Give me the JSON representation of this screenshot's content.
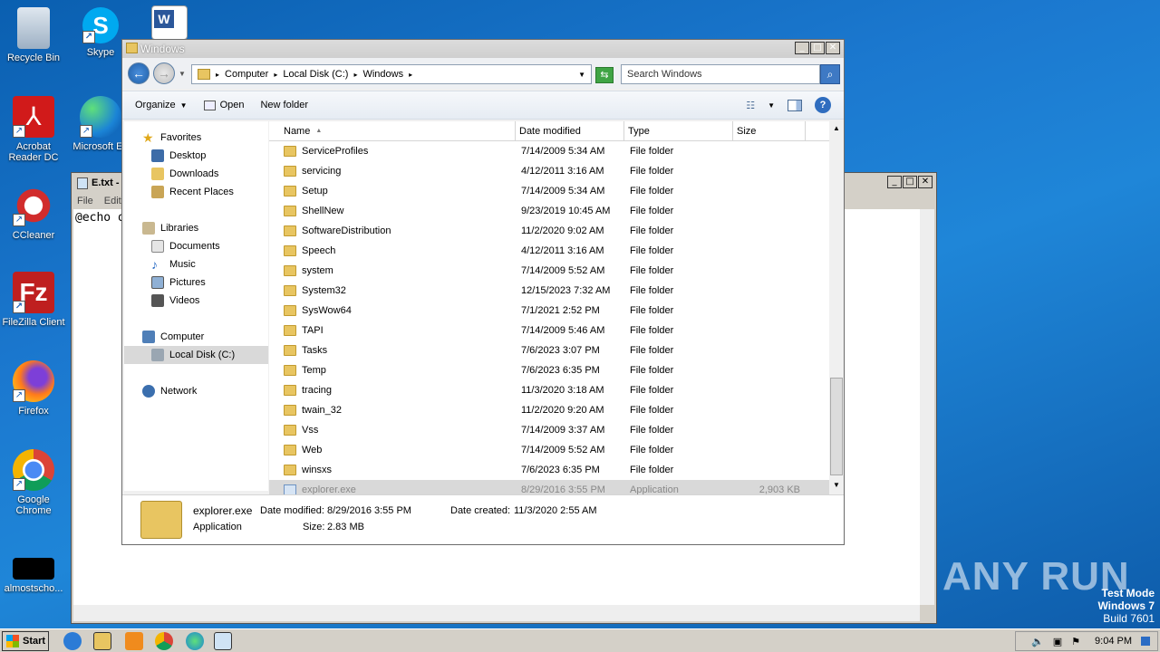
{
  "desktop": {
    "icons": [
      {
        "label": "Recycle Bin"
      },
      {
        "label": "Skype"
      },
      {
        "label": "Acrobat Reader DC"
      },
      {
        "label": "Microsoft Ed"
      },
      {
        "label": "CCleaner"
      },
      {
        "label": "FileZilla Client"
      },
      {
        "label": "Firefox"
      },
      {
        "label": "Google Chrome"
      },
      {
        "label": "almostscho..."
      }
    ],
    "watermark": "ANY RUN",
    "test_mode": {
      "line1": "Test Mode",
      "line2": "Windows 7",
      "line3": "Build 7601"
    }
  },
  "notepad": {
    "title": "E.txt -",
    "menu": [
      "File",
      "Edit"
    ],
    "text": "@echo o"
  },
  "explorer": {
    "title": "Windows",
    "address": {
      "segments": [
        "Computer",
        "Local Disk (C:)",
        "Windows"
      ]
    },
    "search_placeholder": "Search Windows",
    "toolbar": {
      "organize": "Organize",
      "open": "Open",
      "new_folder": "New folder"
    },
    "nav": {
      "favorites": "Favorites",
      "desktop": "Desktop",
      "downloads": "Downloads",
      "recent": "Recent Places",
      "libraries": "Libraries",
      "documents": "Documents",
      "music": "Music",
      "pictures": "Pictures",
      "videos": "Videos",
      "computer": "Computer",
      "local_disk": "Local Disk (C:)",
      "network": "Network"
    },
    "columns": {
      "name": "Name",
      "date": "Date modified",
      "type": "Type",
      "size": "Size"
    },
    "rows": [
      {
        "name": "ServiceProfiles",
        "date": "7/14/2009 5:34 AM",
        "type": "File folder",
        "size": ""
      },
      {
        "name": "servicing",
        "date": "4/12/2011 3:16 AM",
        "type": "File folder",
        "size": ""
      },
      {
        "name": "Setup",
        "date": "7/14/2009 5:34 AM",
        "type": "File folder",
        "size": ""
      },
      {
        "name": "ShellNew",
        "date": "9/23/2019 10:45 AM",
        "type": "File folder",
        "size": ""
      },
      {
        "name": "SoftwareDistribution",
        "date": "11/2/2020 9:02 AM",
        "type": "File folder",
        "size": ""
      },
      {
        "name": "Speech",
        "date": "4/12/2011 3:16 AM",
        "type": "File folder",
        "size": ""
      },
      {
        "name": "system",
        "date": "7/14/2009 5:52 AM",
        "type": "File folder",
        "size": ""
      },
      {
        "name": "System32",
        "date": "12/15/2023 7:32 AM",
        "type": "File folder",
        "size": ""
      },
      {
        "name": "SysWow64",
        "date": "7/1/2021 2:52 PM",
        "type": "File folder",
        "size": ""
      },
      {
        "name": "TAPI",
        "date": "7/14/2009 5:46 AM",
        "type": "File folder",
        "size": ""
      },
      {
        "name": "Tasks",
        "date": "7/6/2023 3:07 PM",
        "type": "File folder",
        "size": ""
      },
      {
        "name": "Temp",
        "date": "7/6/2023 6:35 PM",
        "type": "File folder",
        "size": ""
      },
      {
        "name": "tracing",
        "date": "11/3/2020 3:18 AM",
        "type": "File folder",
        "size": ""
      },
      {
        "name": "twain_32",
        "date": "11/2/2020 9:20 AM",
        "type": "File folder",
        "size": ""
      },
      {
        "name": "Vss",
        "date": "7/14/2009 3:37 AM",
        "type": "File folder",
        "size": ""
      },
      {
        "name": "Web",
        "date": "7/14/2009 5:52 AM",
        "type": "File folder",
        "size": ""
      },
      {
        "name": "winsxs",
        "date": "7/6/2023 6:35 PM",
        "type": "File folder",
        "size": ""
      },
      {
        "name": "explorer.exe",
        "date": "8/29/2016 3:55 PM",
        "type": "Application",
        "size": "2,903 KB"
      }
    ],
    "details": {
      "name": "explorer.exe",
      "type": "Application",
      "modified_label": "Date modified:",
      "modified": "8/29/2016 3:55 PM",
      "size_label": "Size:",
      "size": "2.83 MB",
      "created_label": "Date created:",
      "created": "11/3/2020 2:55 AM"
    }
  },
  "taskbar": {
    "start": "Start",
    "clock": "9:04 PM"
  }
}
